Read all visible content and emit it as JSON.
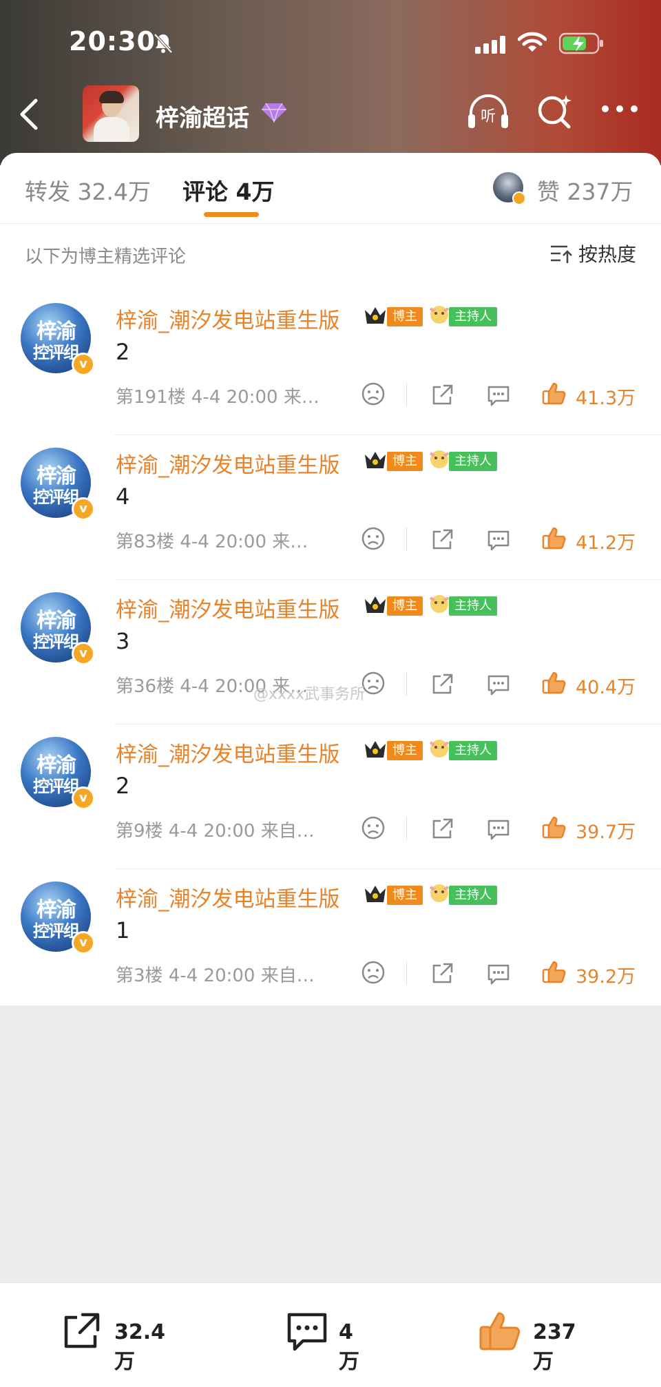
{
  "status": {
    "time": "20:30"
  },
  "nav": {
    "title": "梓渝超话"
  },
  "tabs": {
    "repost": "转发 32.4万",
    "comment": "评论 4万",
    "like": "赞 237万"
  },
  "subheader": "以下为博主精选评论",
  "sort_label": "按热度",
  "comments": [
    {
      "user": "梓渝_潮汐发电站重生版",
      "badge_host": "博主",
      "badge_mod": "主持人",
      "text": "2",
      "meta": "第191楼 4-4 20:00 来…",
      "likes": "41.3万"
    },
    {
      "user": "梓渝_潮汐发电站重生版",
      "badge_host": "博主",
      "badge_mod": "主持人",
      "text": "4",
      "meta": "第83楼 4-4 20:00 来…",
      "likes": "41.2万"
    },
    {
      "user": "梓渝_潮汐发电站重生版",
      "badge_host": "博主",
      "badge_mod": "主持人",
      "text": "3",
      "meta": "第36楼 4-4 20:00 来…",
      "likes": "40.4万"
    },
    {
      "user": "梓渝_潮汐发电站重生版",
      "badge_host": "博主",
      "badge_mod": "主持人",
      "text": "2",
      "meta": "第9楼 4-4 20:00 来自…",
      "likes": "39.7万"
    },
    {
      "user": "梓渝_潮汐发电站重生版",
      "badge_host": "博主",
      "badge_mod": "主持人",
      "text": "1",
      "meta": "第3楼 4-4 20:00 来自…",
      "likes": "39.2万"
    }
  ],
  "avatar_text": {
    "big": "梓渝",
    "small": "控评组"
  },
  "watermark": "@xxxx武事务所",
  "bottom": {
    "repost": "32.4万",
    "comment": "4万",
    "like": "237万"
  },
  "colors": {
    "accent": "#e8832a",
    "host_badge": "#f08a1c",
    "mod_badge": "#45c05b",
    "verify": "#f5a623"
  },
  "icons": [
    "bell-off-icon",
    "signal-icon",
    "wifi-icon",
    "battery-charging-icon",
    "back-icon",
    "gem-icon",
    "listen-icon",
    "super-search-icon",
    "more-icon",
    "sort-icon",
    "crown-icon",
    "sad-face-icon",
    "share-icon",
    "reply-icon",
    "thumb-up-icon"
  ]
}
